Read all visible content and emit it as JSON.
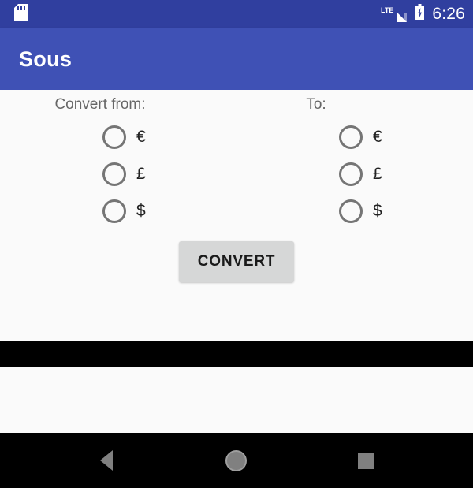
{
  "status_bar": {
    "sd_card_icon": "sd-card-icon",
    "network_label": "LTE",
    "signal_icon": "signal-bars-icon",
    "battery_icon": "battery-charging-icon",
    "clock": "6:26",
    "background_color": "#303f9f"
  },
  "app_bar": {
    "title": "Sous",
    "background_color": "#3f51b5",
    "title_color": "#ffffff"
  },
  "content": {
    "background_color": "#fafafa",
    "from_column": {
      "label": "Convert from:",
      "options": [
        {
          "symbol": "€",
          "name": "euro",
          "selected": false
        },
        {
          "symbol": "£",
          "name": "pound",
          "selected": false
        },
        {
          "symbol": "$",
          "name": "dollar",
          "selected": false
        }
      ]
    },
    "to_column": {
      "label": "To:",
      "options": [
        {
          "symbol": "€",
          "name": "euro",
          "selected": false
        },
        {
          "symbol": "£",
          "name": "pound",
          "selected": false
        },
        {
          "symbol": "$",
          "name": "dollar",
          "selected": false
        }
      ]
    },
    "convert_button": {
      "label": "CONVERT",
      "background_color": "#d6d7d7",
      "text_color": "#1a1a1a"
    }
  },
  "nav_bar": {
    "background_color": "#000000",
    "back_icon": "triangle-back-icon",
    "home_icon": "circle-home-icon",
    "recents_icon": "square-recents-icon"
  }
}
